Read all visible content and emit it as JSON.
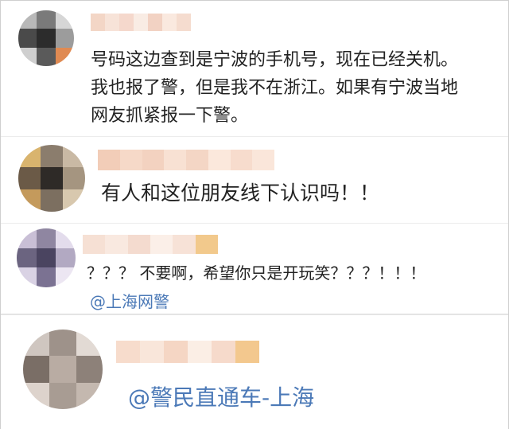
{
  "comments": [
    {
      "lines": [
        "号码这边查到是宁波的手机号，现在已经关机。",
        "我也报了警，但是我不在浙江。如果有宁波当地",
        "网友抓紧报一下警。"
      ],
      "avatar_colors": [
        "#b8b8b8",
        "#7a7a7a",
        "#d6d6d6",
        "#4a4a4a",
        "#2c2c2c",
        "#9c9c9c",
        "#cfcfcf",
        "#5a5a5a",
        "#e08a52"
      ],
      "name_colors": [
        "#f3d6c6",
        "#f7e3d8",
        "#f5d8cc",
        "#f9ece4",
        "#f2d2c3",
        "#fae9df",
        "#f5dccf"
      ]
    },
    {
      "lines": [
        "有人和这位朋友线下认识吗！！"
      ],
      "avatar_colors": [
        "#d9b46e",
        "#8b7d6d",
        "#c9b9a4",
        "#6b5a47",
        "#2e2a27",
        "#a59580",
        "#c49a5c",
        "#7c6f60",
        "#d8c8ae"
      ],
      "name_colors": [
        "#f2cdb8",
        "#f6d9c8",
        "#f3d2c0",
        "#f8e1d3",
        "#f4d6c5",
        "#fbe8dc",
        "#f7dccd",
        "#fae6da"
      ]
    },
    {
      "lines": [
        "？？？ 不要啊，希望你只是开玩笑？？？！！！"
      ],
      "mention": "@上海网警",
      "avatar_colors": [
        "#c9bfd6",
        "#8f86a1",
        "#e3dcec",
        "#6b6480",
        "#4a4460",
        "#b2a9c2",
        "#d9d2e4",
        "#7b7292",
        "#ece6f2"
      ],
      "name_colors": [
        "#f6e0d4",
        "#f9e9e0",
        "#f4dbcf",
        "#fbefe8",
        "#f7e2d7",
        "#f2c98c"
      ]
    },
    {
      "mention": "@警民直通车-上海",
      "avatar_colors": [
        "#cfc6c0",
        "#9e928a",
        "#e2dad4",
        "#7a6e66",
        "#b9aca3",
        "#8d8179",
        "#ddd3cc",
        "#a89c93",
        "#c4b8af"
      ],
      "name_colors": [
        "#f7dccc",
        "#f9e6da",
        "#f5d6c4",
        "#fbeee5",
        "#f6dacb",
        "#f3c88e"
      ]
    }
  ]
}
